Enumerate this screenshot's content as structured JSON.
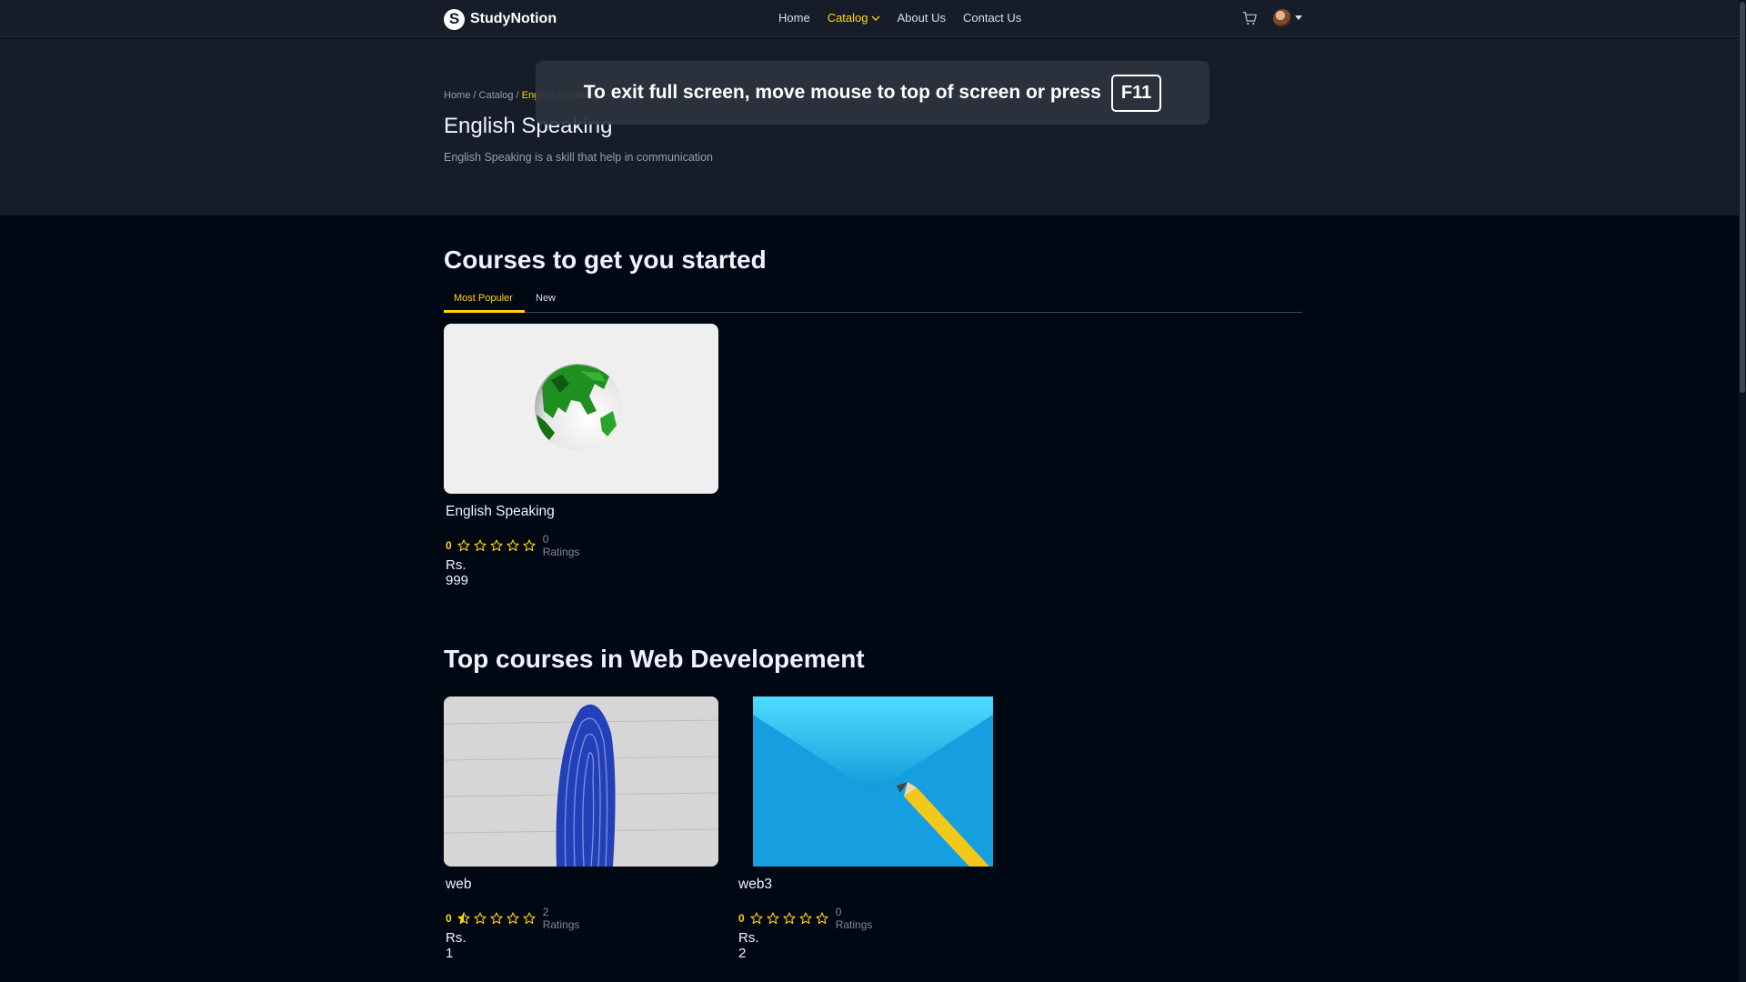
{
  "nav": {
    "logo_text": "StudyNotion",
    "logo_letter": "S",
    "links": [
      "Home",
      "Catalog",
      "About Us",
      "Contact Us"
    ]
  },
  "breadcrumb": {
    "home": "Home",
    "sep": " / ",
    "catalog": "Catalog",
    "current": "English Speaking"
  },
  "hero": {
    "title": "English Speaking",
    "description": "English Speaking is a skill that help in communication"
  },
  "fullscreen_toast": {
    "message": "To exit full screen, move mouse to top of screen or press",
    "key": "F11"
  },
  "section1": {
    "title": "Courses to get you started",
    "tabs": [
      "Most Populer",
      "New"
    ],
    "courses": [
      {
        "name": "English Speaking",
        "rating": "0",
        "rating_value": 0,
        "ratings_count": "0 Ratings",
        "price": "Rs. 999",
        "thumb": "globe-image"
      }
    ]
  },
  "section2": {
    "title": "Top courses in Web Developement",
    "courses": [
      {
        "name": "web",
        "rating": "0",
        "rating_value": 0.5,
        "ratings_count": "2 Ratings",
        "price": "Rs. 1",
        "thumb": "fingerprint-image"
      },
      {
        "name": "web3",
        "rating": "0",
        "rating_value": 0,
        "ratings_count": "0 Ratings",
        "price": "Rs. 2",
        "thumb": "envelope-image"
      }
    ]
  },
  "colors": {
    "accent": "#FFD60A",
    "navbar_bg": "#161D29",
    "page_bg": "#000814"
  }
}
